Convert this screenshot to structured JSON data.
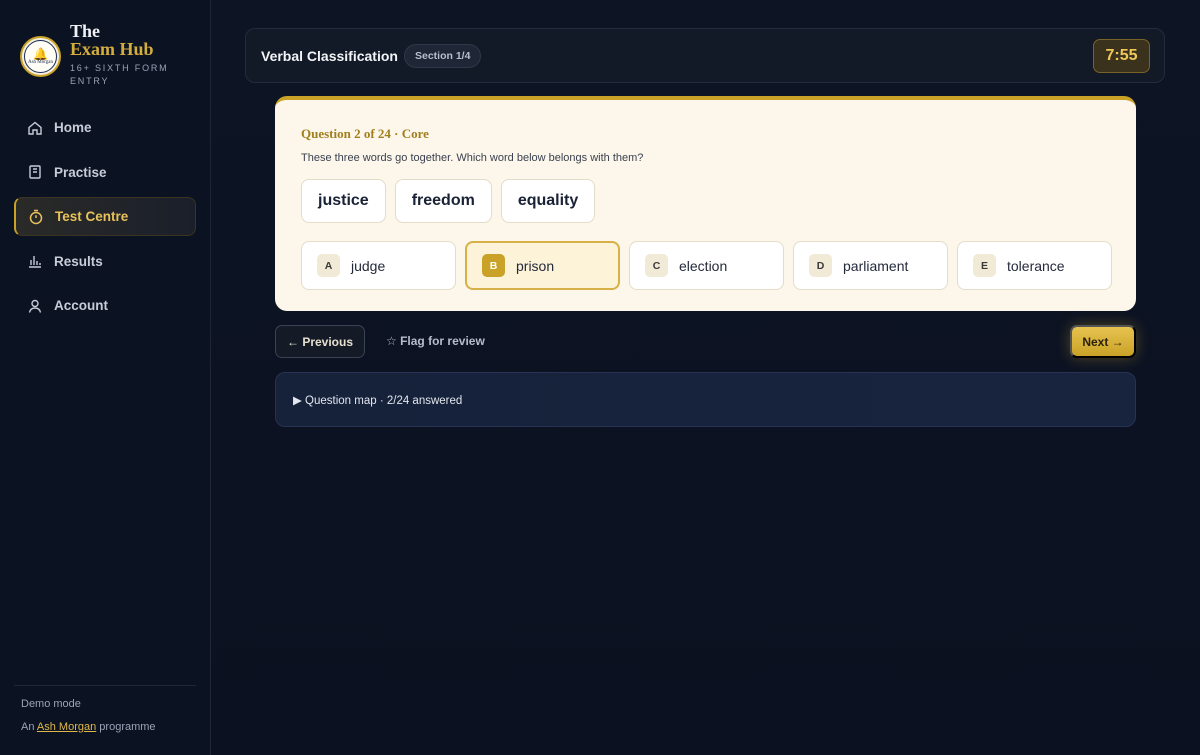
{
  "brand": {
    "the": "The",
    "hub": "Exam Hub",
    "subtitle": "16+ SIXTH FORM ENTRY",
    "logo_text": "Ash Morgan"
  },
  "nav": {
    "items": [
      {
        "label": "Home",
        "icon": "home-icon",
        "active": false
      },
      {
        "label": "Practise",
        "icon": "book-icon",
        "active": false
      },
      {
        "label": "Test Centre",
        "icon": "stopwatch-icon",
        "active": true
      },
      {
        "label": "Results",
        "icon": "bar-chart-icon",
        "active": false
      },
      {
        "label": "Account",
        "icon": "user-icon",
        "active": false
      }
    ]
  },
  "footer": {
    "mode": "Demo mode",
    "prefix": "An",
    "link": "Ash Morgan",
    "suffix": "programme"
  },
  "header": {
    "title": "Verbal Classification",
    "section": "Section 1/4",
    "timer": "7:55"
  },
  "question": {
    "meta": "Question 2 of 24 · Core",
    "prompt": "These three words go together. Which word below belongs with them?",
    "stems": [
      "justice",
      "freedom",
      "equality"
    ],
    "options": [
      {
        "letter": "A",
        "text": "judge",
        "selected": false
      },
      {
        "letter": "B",
        "text": "prison",
        "selected": true
      },
      {
        "letter": "C",
        "text": "election",
        "selected": false
      },
      {
        "letter": "D",
        "text": "parliament",
        "selected": false
      },
      {
        "letter": "E",
        "text": "tolerance",
        "selected": false
      }
    ]
  },
  "controls": {
    "previous": "← Previous",
    "flag": "☆ Flag for review",
    "next": "Next →"
  },
  "question_map": {
    "label": "▶ Question map · 2/24 answered"
  },
  "colors": {
    "accent": "#c9a227",
    "background": "#0d1424",
    "card": "#fcf7ea"
  }
}
